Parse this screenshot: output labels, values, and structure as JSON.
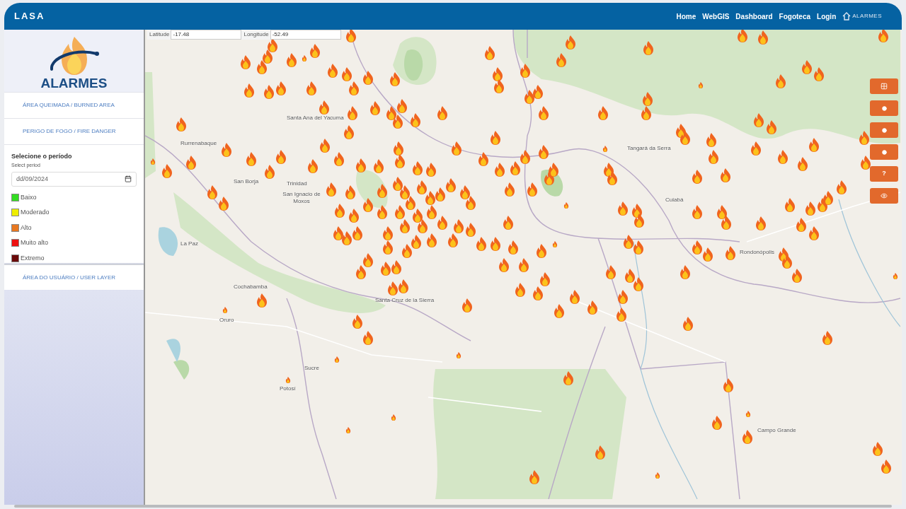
{
  "header": {
    "logo": "LASA",
    "nav": [
      {
        "label": "Home"
      },
      {
        "label": "WebGIS"
      },
      {
        "label": "Dashboard"
      },
      {
        "label": "Fogoteca"
      },
      {
        "label": "Login"
      }
    ],
    "brand": "ALARMES"
  },
  "sidebar": {
    "logo_text": "ALARMES",
    "sections": [
      {
        "label": "ÁREA QUEIMADA / BURNED AREA"
      },
      {
        "label": "PERIGO DE FOGO / FIRE DANGER"
      }
    ],
    "period": {
      "title": "Selecione o período",
      "subtitle": "Select period",
      "date": "dd/09/2024"
    },
    "legend": [
      {
        "label": "Baixo",
        "color": "#33dd22"
      },
      {
        "label": "Moderado",
        "color": "#eeee00"
      },
      {
        "label": "Alto",
        "color": "#e87820"
      },
      {
        "label": "Muito alto",
        "color": "#ee1111"
      },
      {
        "label": "Extremo",
        "color": "#6a0a0a"
      }
    ],
    "user_layer": "ÁREA DO USUÁRIO / USER LAYER"
  },
  "map": {
    "coords": [
      {
        "label": "Latitude",
        "value": "-17.48"
      },
      {
        "label": "Longitude",
        "value": "-52.49"
      }
    ],
    "places": [
      "Santa Ana del Yacuma",
      "Rurrenabaque",
      "Tangará da Serra",
      "San Borja",
      "Trinidad",
      "San Ignacio de Moxos",
      "Cuiabá",
      "La Paz",
      "Rondonópolis",
      "Cochabamba",
      "Santa Cruz de la Sierra",
      "Oruro",
      "Sucre",
      "Potosí",
      "Campo Grande"
    ],
    "tools": [
      {
        "kind": "grid"
      },
      {
        "kind": "dot"
      },
      {
        "kind": "dot"
      },
      {
        "kind": "dot"
      },
      {
        "kind": "text",
        "label": "?"
      },
      {
        "kind": "eye"
      }
    ]
  }
}
